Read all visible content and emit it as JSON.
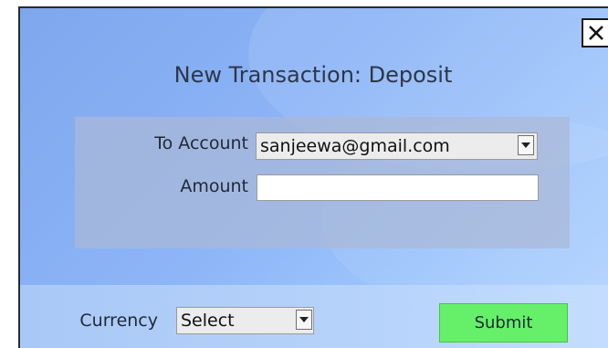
{
  "dialog": {
    "title": "New Transaction: Deposit",
    "close_icon": "close-icon"
  },
  "form": {
    "to_account": {
      "label": "To Account",
      "selected": "sanjeewa@gmail.com",
      "arrow_icon": "chevron-down-icon"
    },
    "amount": {
      "label": "Amount",
      "value": "",
      "placeholder": ""
    }
  },
  "footer": {
    "currency": {
      "label": "Currency",
      "selected": "Select",
      "arrow_icon": "chevron-down-icon"
    },
    "submit_label": "Submit"
  },
  "colors": {
    "background_gradient_start": "#7ea7ee",
    "background_gradient_end": "#b4d5ff",
    "form_box": "#aab9d7",
    "submit_button": "#66f06a"
  }
}
